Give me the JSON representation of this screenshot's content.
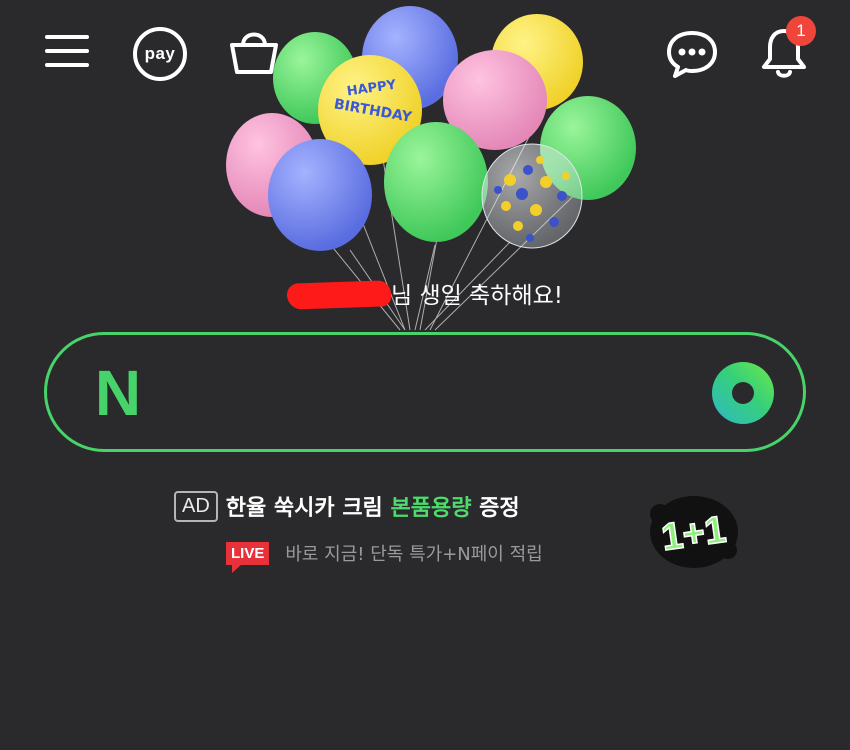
{
  "header": {
    "menu_icon": "hamburger-menu-icon",
    "pay_label": "pay",
    "shopping_icon": "shopping-bag-icon",
    "talk_icon": "chat-bubble-icon",
    "bell_icon": "bell-icon",
    "notification_count": "1"
  },
  "birthday": {
    "balloon_text_line1": "HAPPY",
    "balloon_text_line2": "BIRTHDAY",
    "greeting_suffix": "님 생일 축하해요!"
  },
  "search": {
    "logo_letter": "N",
    "placeholder": "",
    "brand_green": "#47d36a",
    "lens_icon": "green-lens-icon"
  },
  "ad": {
    "ad_label": "AD",
    "title_before": "한율 쑥시카 크림 ",
    "title_highlight": "본품용량",
    "title_after": " 증정",
    "live_label": "LIVE",
    "subtitle": "바로 지금! 단독 특가+N페이 적립",
    "promo_badge": "1+1"
  },
  "colors": {
    "background": "#2a2a2c",
    "accent_green": "#4ddc6b",
    "notification_red": "#f0453a",
    "live_red": "#e8323a"
  }
}
